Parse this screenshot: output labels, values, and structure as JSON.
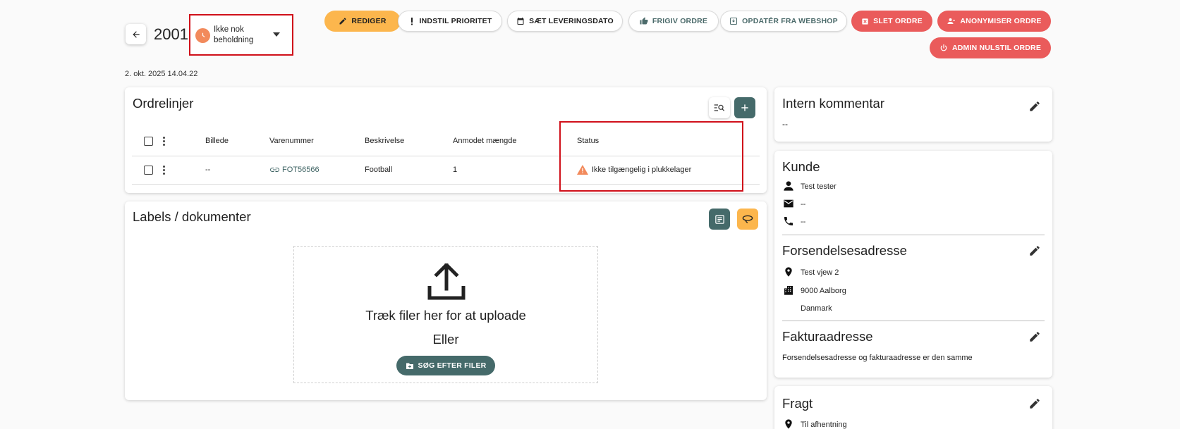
{
  "header": {
    "order_number": "2001",
    "status_label": "Ikke nok beholdning",
    "created": "2. okt. 2025 14.04.22"
  },
  "actions": {
    "edit": "REDIGER",
    "set_priority": "INDSTIL PRIORITET",
    "set_delivery_date": "SÆT LEVERINGSDATO",
    "release_order": "FRIGIV ORDRE",
    "update_from_webshop": "OPDATÉR FRA WEBSHOP",
    "delete_order": "SLET ORDRE",
    "anonymize_order": "ANONYMISER ORDRE",
    "admin_reset_order": "ADMIN NULSTIL ORDRE"
  },
  "order_lines": {
    "title": "Ordrelinjer",
    "columns": [
      "Billede",
      "Varenummer",
      "Beskrivelse",
      "Anmodet mængde",
      "Status"
    ],
    "rows": [
      {
        "image": "--",
        "sku": "FOT56566",
        "description": "Football",
        "quantity": "1",
        "status": "Ikke tilgængelig i plukkelager"
      }
    ]
  },
  "labels": {
    "title": "Labels / dokumenter",
    "drop_text": "Træk filer her for at uploade",
    "or_text": "Eller",
    "browse_button": "SØG EFTER FILER"
  },
  "internal_comment": {
    "title": "Intern kommentar",
    "value": "--"
  },
  "customer": {
    "title": "Kunde",
    "name": "Test tester",
    "email": "--",
    "phone": "--"
  },
  "shipping_address": {
    "title": "Forsendelsesadresse",
    "street": "Test vjew 2",
    "city": "9000 Aalborg",
    "country": "Danmark"
  },
  "billing_address": {
    "title": "Fakturaadresse",
    "note": "Forsendelsesadresse og fakturaadresse er den samme"
  },
  "freight": {
    "title": "Fragt",
    "method": "Til afhentning"
  },
  "colors": {
    "teal": "#456a6a",
    "yellow": "#fcb64d",
    "red": "#ea5b5b",
    "status_orange": "#f28a5c",
    "highlight_red": "#d0101a"
  },
  "icons": [
    "arrow-left-icon",
    "clock-icon",
    "caret-down-icon",
    "pencil-icon",
    "exclamation-icon",
    "calendar-icon",
    "thumb-up-icon",
    "download-box-icon",
    "delete-box-icon",
    "person-remove-icon",
    "power-icon",
    "list-search-icon",
    "plus-icon",
    "link-icon",
    "warning-icon",
    "document-add-icon",
    "lasso-icon",
    "upload-icon",
    "folder-plus-icon",
    "person-icon",
    "mail-icon",
    "phone-icon",
    "location-pin-icon",
    "buildings-icon"
  ]
}
